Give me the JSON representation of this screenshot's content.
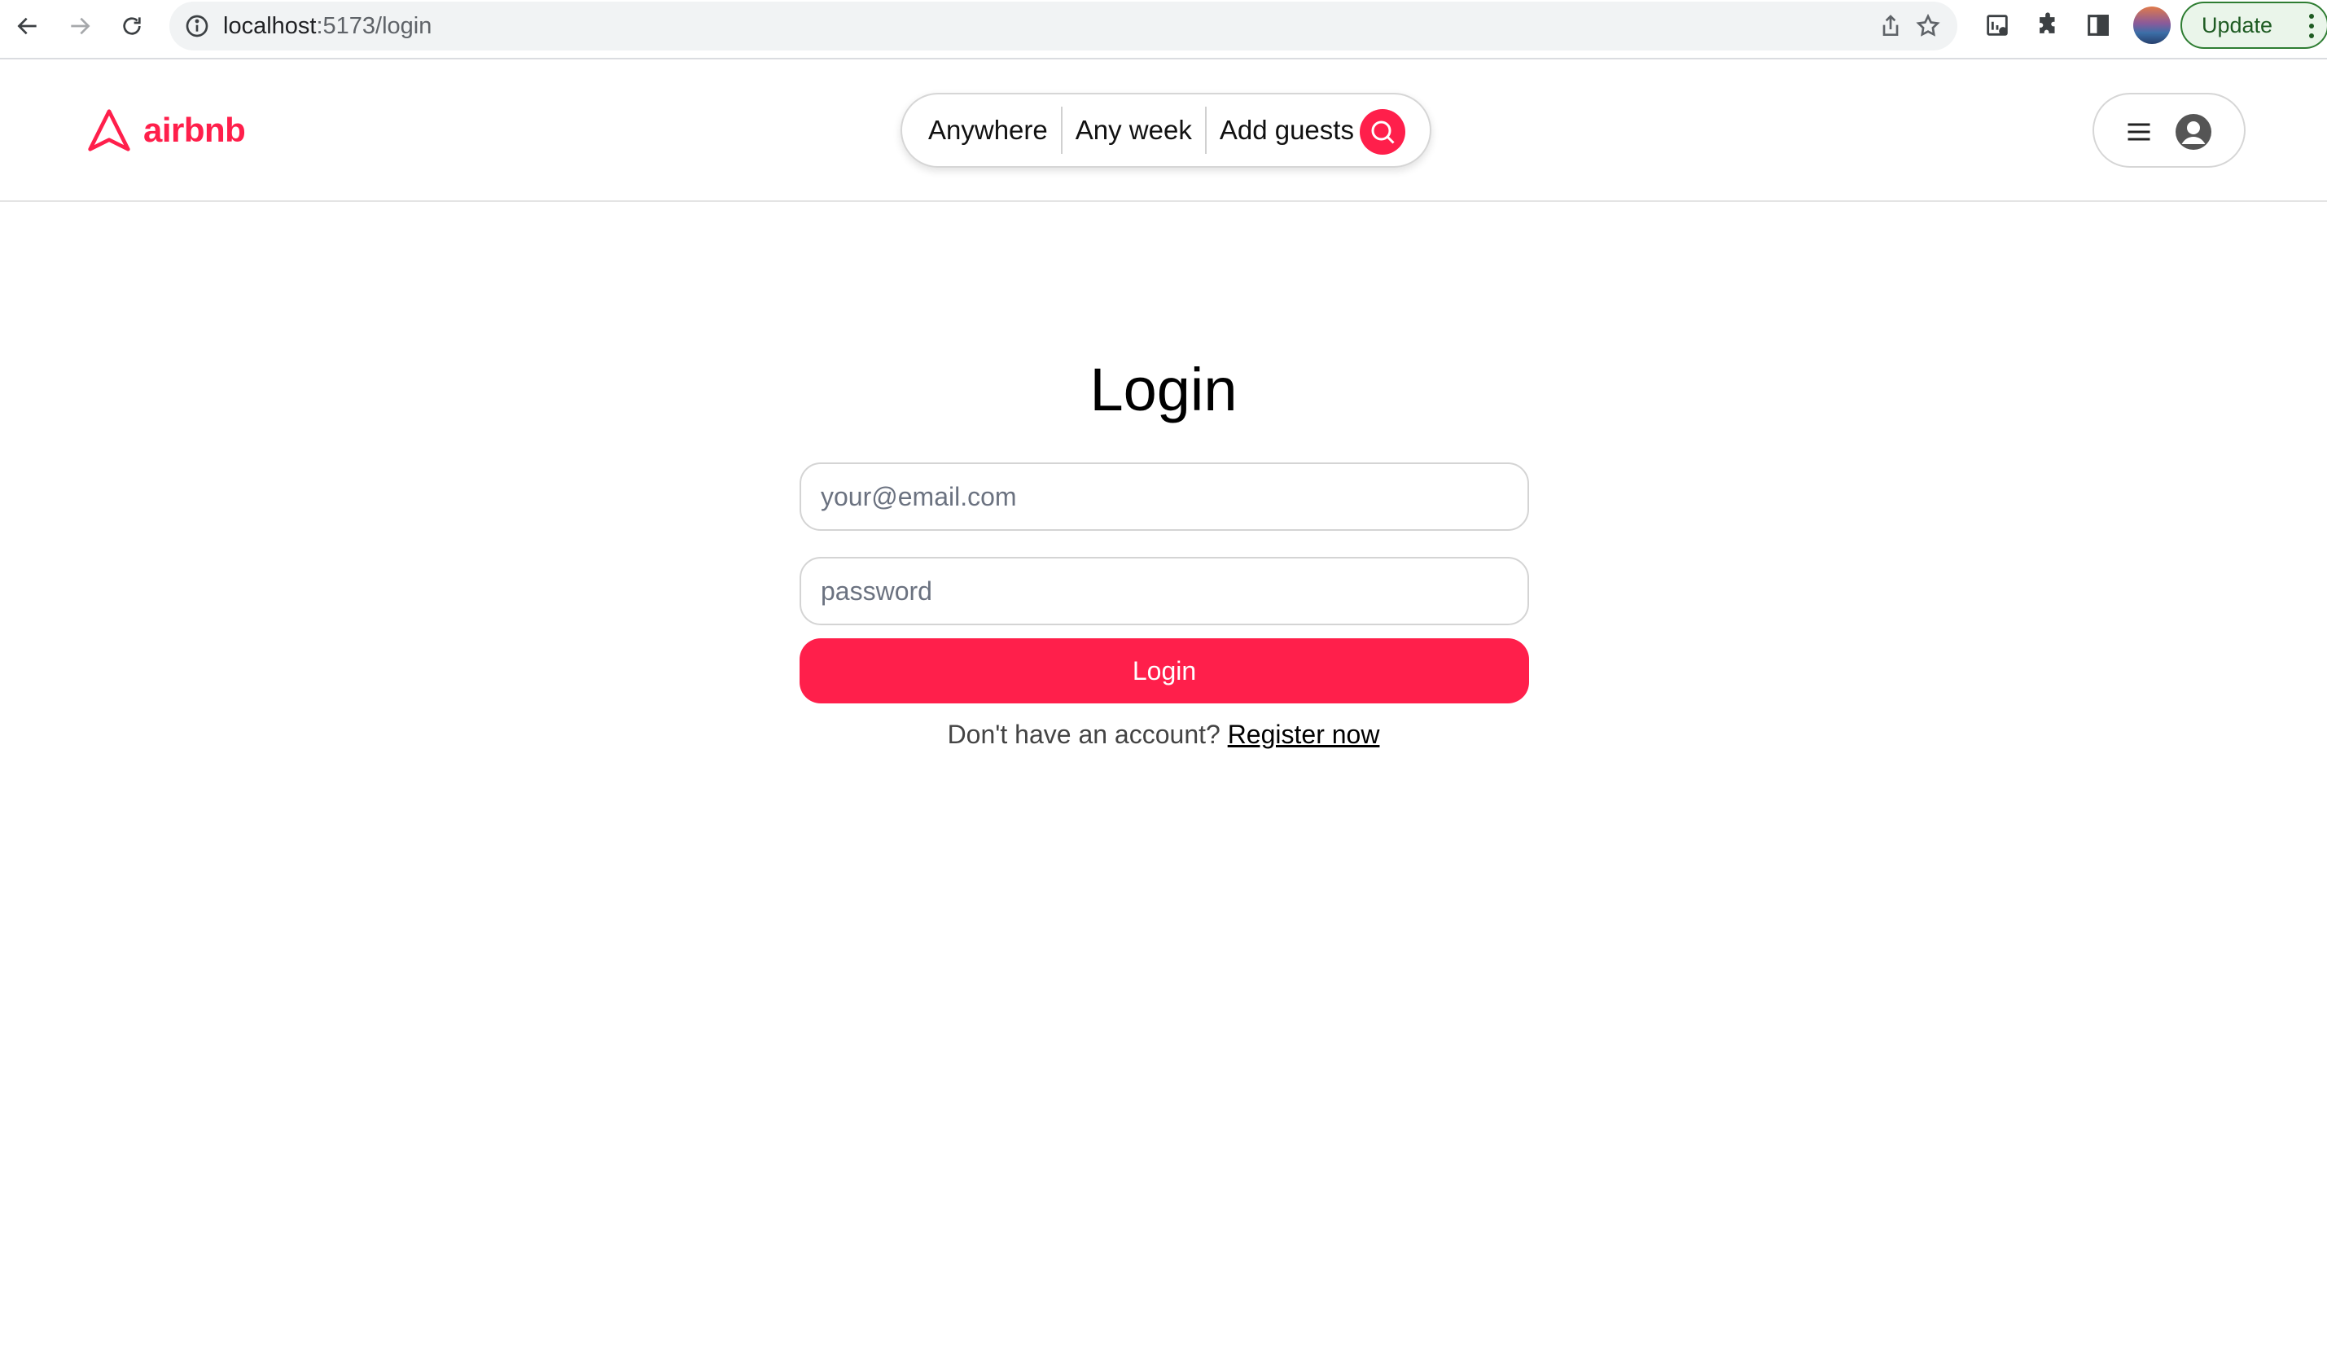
{
  "browser": {
    "url_host": "localhost",
    "url_path": ":5173/login",
    "update_label": "Update",
    "icons": [
      "back-arrow-icon",
      "forward-arrow-icon",
      "reload-icon",
      "site-info-icon",
      "share-icon",
      "bookmark-star-icon",
      "extension-icon",
      "puzzle-icon",
      "side-panel-icon",
      "profile-avatar",
      "more-vert-icon"
    ]
  },
  "header": {
    "logo_text": "airbnb",
    "search_pill": {
      "anywhere": "Anywhere",
      "any_week": "Any week",
      "add_guests": "Add guests"
    }
  },
  "login": {
    "title": "Login",
    "email_placeholder": "your@email.com",
    "password_placeholder": "password",
    "button_label": "Login",
    "no_account_text": "Don't have an account?",
    "register_link": "Register now"
  },
  "colors": {
    "brand": "#ff1f4b",
    "update_green": "#1e5b22"
  }
}
